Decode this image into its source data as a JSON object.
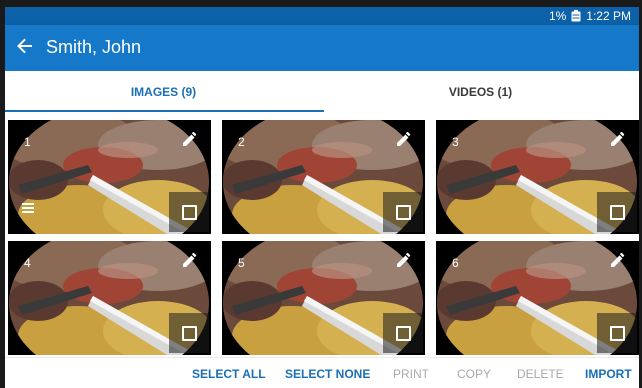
{
  "statusbar": {
    "battery": "1%",
    "time": "1:22 PM"
  },
  "appbar": {
    "title": "Smith, John"
  },
  "tabs": [
    {
      "label": "IMAGES (9)",
      "active": true
    },
    {
      "label": "VIDEOS (1)",
      "active": false
    }
  ],
  "thumbnails": [
    {
      "number": "1",
      "has_notes": true
    },
    {
      "number": "2",
      "has_notes": false
    },
    {
      "number": "3",
      "has_notes": false
    },
    {
      "number": "4",
      "has_notes": false
    },
    {
      "number": "5",
      "has_notes": false
    },
    {
      "number": "6",
      "has_notes": false
    }
  ],
  "actions": {
    "select_all": "SELECT ALL",
    "select_none": "SELECT NONE",
    "print": "PRINT",
    "copy": "COPY",
    "delete": "DELETE",
    "import": "IMPORT"
  },
  "colors": {
    "statusbar": "#0d61a8",
    "appbar": "#1678c8",
    "accent": "#1a6fb6",
    "disabled": "#a9a9a9"
  }
}
